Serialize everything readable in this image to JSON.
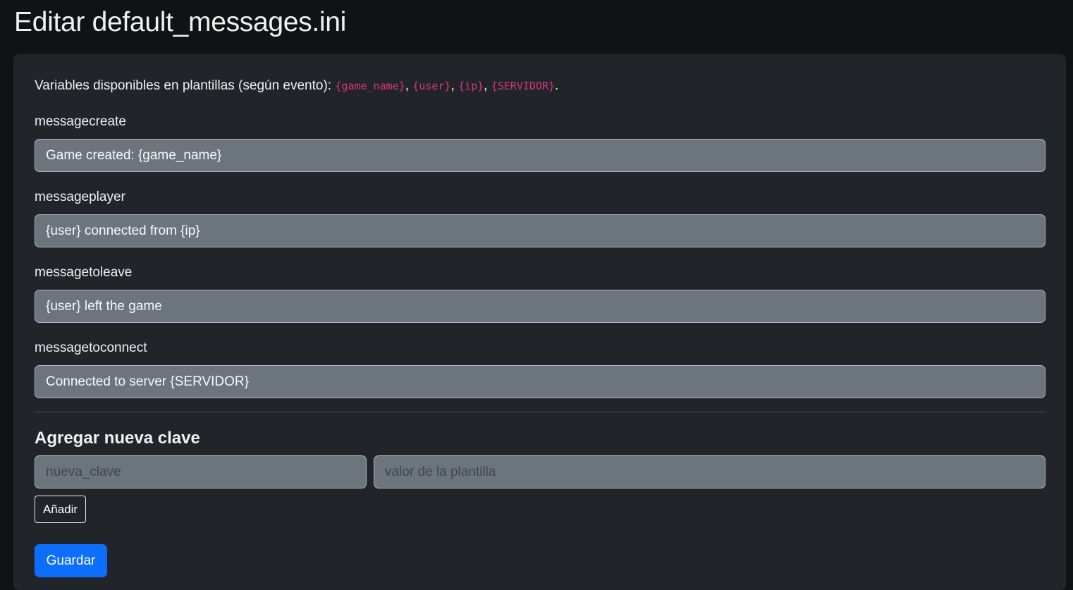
{
  "page": {
    "title": "Editar default_messages.ini"
  },
  "variables": {
    "intro": "Variables disponibles en plantillas (según evento): ",
    "items": [
      "{game_name}",
      "{user}",
      "{ip}",
      "{SERVIDOR}"
    ],
    "separator": ", ",
    "end": "."
  },
  "fields": [
    {
      "key": "messagecreate",
      "value": "Game created: {game_name}"
    },
    {
      "key": "messageplayer",
      "value": "{user} connected from {ip}"
    },
    {
      "key": "messagetoleave",
      "value": "{user} left the game"
    },
    {
      "key": "messagetoconnect",
      "value": "Connected to server {SERVIDOR}"
    }
  ],
  "add_section": {
    "title": "Agregar nueva clave",
    "key_placeholder": "nueva_clave",
    "value_placeholder": "valor de la plantilla",
    "add_label": "Añadir"
  },
  "save_label": "Guardar",
  "colors": {
    "accent": "#0d6efd",
    "code": "#d63384",
    "card": "#212529",
    "input": "#6c757d"
  }
}
